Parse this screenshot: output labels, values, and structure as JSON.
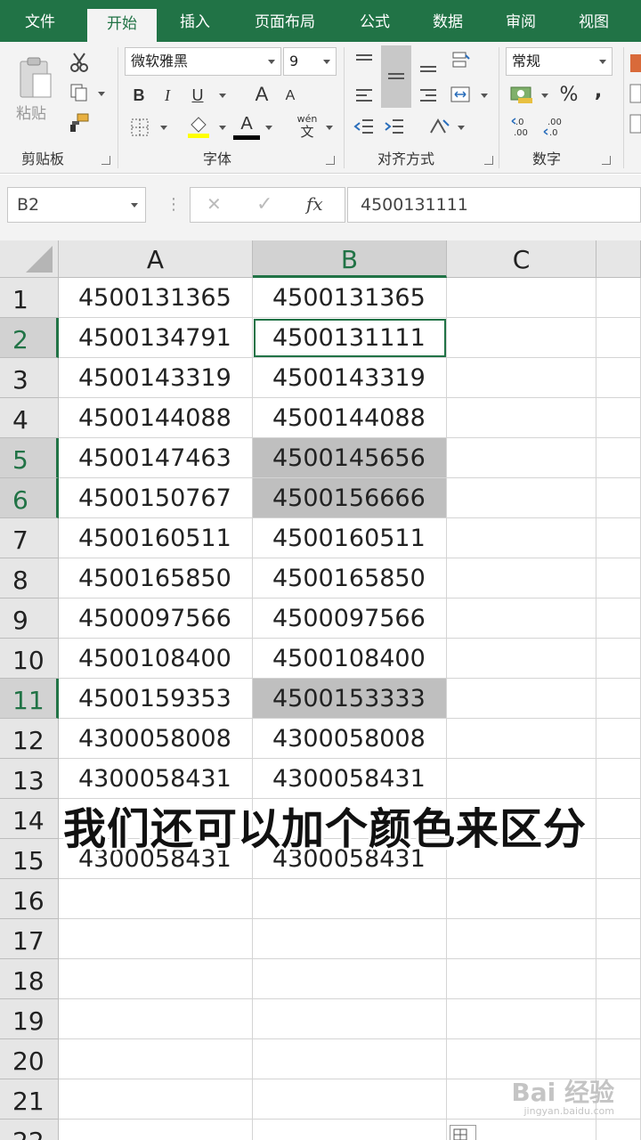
{
  "tabs": [
    "文件",
    "开始",
    "插入",
    "页面布局",
    "公式",
    "数据",
    "审阅",
    "视图"
  ],
  "active_tab": "开始",
  "ribbon": {
    "clipboard": {
      "paste_label": "粘贴",
      "group_label": "剪贴板"
    },
    "font": {
      "font_name": "微软雅黑",
      "font_size": "9",
      "bold": "B",
      "italic": "I",
      "underline": "U",
      "grow": "A",
      "shrink": "A",
      "font_color": "A",
      "phonetic_top": "wén",
      "phonetic_bottom": "文",
      "group_label": "字体"
    },
    "alignment": {
      "group_label": "对齐方式"
    },
    "number": {
      "format": "常规",
      "percent": "%",
      "comma": ",",
      "group_label": "数字"
    }
  },
  "formula_bar": {
    "name_box": "B2",
    "cancel": "✕",
    "enter": "✓",
    "fx": "fx",
    "value": "4500131111"
  },
  "columns": [
    "A",
    "B",
    "C"
  ],
  "selected_column": "B",
  "row_numbers": [
    "1",
    "2",
    "3",
    "4",
    "5",
    "6",
    "7",
    "8",
    "9",
    "10",
    "11",
    "12",
    "13",
    "14",
    "15",
    "16",
    "17",
    "18",
    "19",
    "20",
    "21",
    "22"
  ],
  "selected_rows": [
    "2",
    "5",
    "6",
    "11"
  ],
  "rows": [
    {
      "a": "4500131365",
      "b": "4500131365",
      "shade": false
    },
    {
      "a": "4500134791",
      "b": "4500131111",
      "shade": false
    },
    {
      "a": "4500143319",
      "b": "4500143319",
      "shade": false
    },
    {
      "a": "4500144088",
      "b": "4500144088",
      "shade": false
    },
    {
      "a": "4500147463",
      "b": "4500145656",
      "shade": true
    },
    {
      "a": "4500150767",
      "b": "4500156666",
      "shade": true
    },
    {
      "a": "4500160511",
      "b": "4500160511",
      "shade": false
    },
    {
      "a": "4500165850",
      "b": "4500165850",
      "shade": false
    },
    {
      "a": "4500097566",
      "b": "4500097566",
      "shade": false
    },
    {
      "a": "4500108400",
      "b": "4500108400",
      "shade": false
    },
    {
      "a": "4500159353",
      "b": "4500153333",
      "shade": true
    },
    {
      "a": "4300058008",
      "b": "4300058008",
      "shade": false
    },
    {
      "a": "4300058431",
      "b": "4300058431",
      "shade": false
    },
    {
      "a": "",
      "b": "",
      "shade": false
    },
    {
      "a": "4300058431",
      "b": "4300058431",
      "shade": false
    }
  ],
  "active_cell_row": 2,
  "caption": "我们还可以加个颜色来区分",
  "watermark": {
    "brand": "Bai 经验",
    "url": "jingyan.baidu.com"
  },
  "colors": {
    "excel_green": "#217346",
    "shade": "#bfbfbf"
  }
}
